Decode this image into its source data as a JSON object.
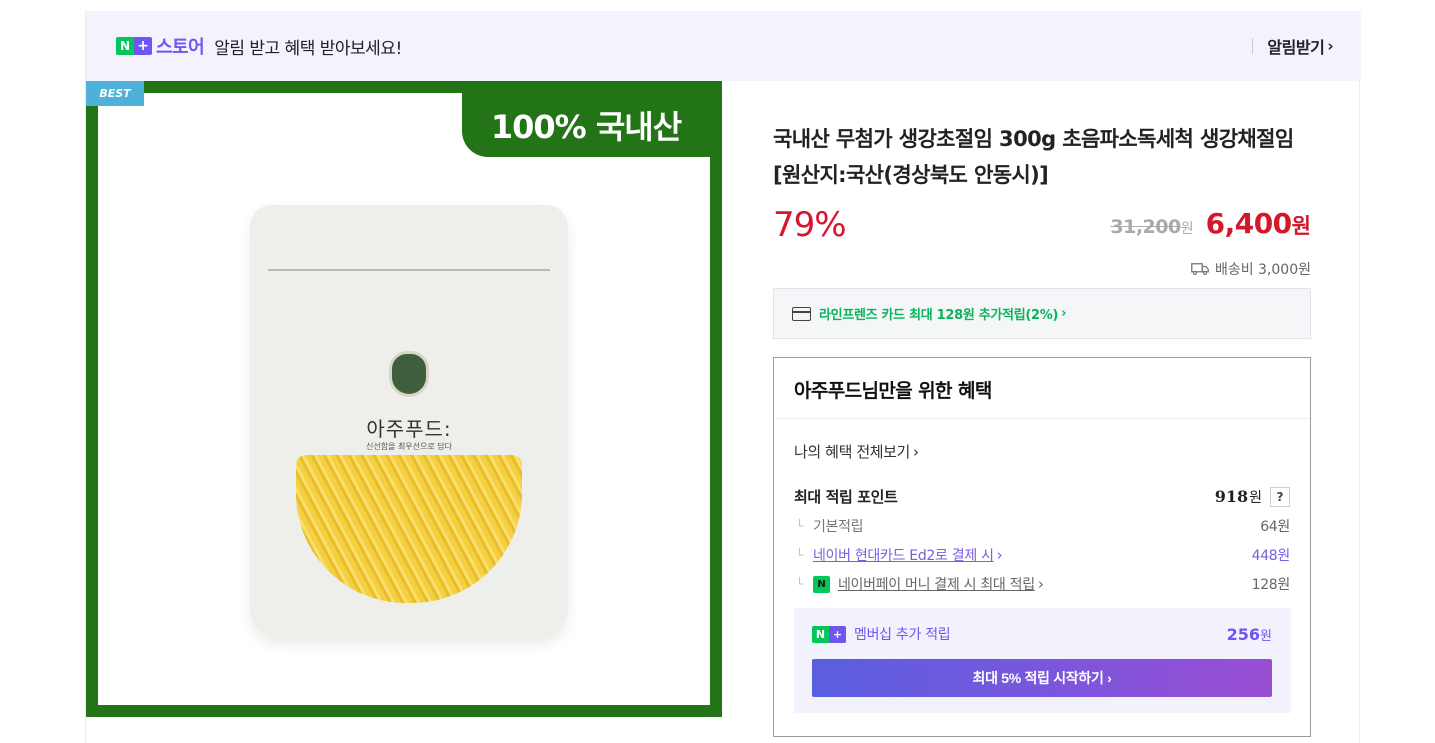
{
  "banner": {
    "n_letter": "N",
    "plus_letter": "+",
    "store_label": "스토어",
    "message": "알림 받고 혜택 받아보세요!",
    "alarm_label": "알림받기",
    "chevron": "›"
  },
  "image": {
    "best_badge": "BEST",
    "tag": "100% 국내산",
    "brand_name": "아주푸드:",
    "brand_sub": "신선함을 최우선으로 담다"
  },
  "product": {
    "title": "국내산 무첨가 생강초절임 300g 초음파소독세척 생강채절임 [원산지:국산(경상북도 안동시)]",
    "discount": "79%",
    "original_price": "31,200",
    "original_unit": "원",
    "sale_price": "6,400",
    "sale_unit": "원",
    "shipping": "배송비 3,000원"
  },
  "card_promo": {
    "text": "라인프렌즈 카드 최대 128원 추가적립(2%)",
    "chevron": "›"
  },
  "benefits": {
    "title": "아주푸드님만을 위한 혜택",
    "view_all": "나의 혜택 전체보기",
    "chevron": "›",
    "max_points_label": "최대 적립 포인트",
    "max_points_value": "918",
    "max_points_unit": "원",
    "help": "?",
    "branch_glyph": "└",
    "items": [
      {
        "label": "기본적립",
        "value": "64원"
      },
      {
        "label": "네이버 현대카드 Ed2로 결제 시",
        "value": "448원"
      },
      {
        "label": "네이버페이 머니 결제 시 최대 적립",
        "value": "128원"
      }
    ],
    "npay_letter": "N",
    "membership": {
      "label": "멤버십 추가 적립",
      "value": "256",
      "unit": "원",
      "button": "최대 5% 적립 시작하기 ›"
    }
  },
  "colors": {
    "naver_green": "#03c75a",
    "plus_purple": "#6f55f2",
    "sale_red": "#d5172b",
    "image_green": "#237317"
  }
}
